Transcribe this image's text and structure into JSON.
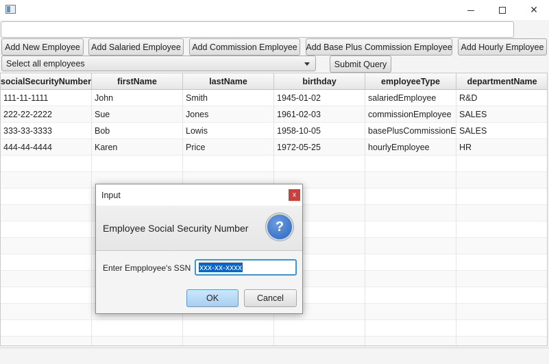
{
  "window": {
    "title": "",
    "icon": "app-window-icon",
    "minimize_icon": "minimize-icon",
    "maximize_icon": "maximize-icon",
    "close_icon": "close-icon",
    "close_label": "✕"
  },
  "query": {
    "value": "",
    "placeholder": ""
  },
  "buttons": {
    "add_new": "Add New Employee",
    "add_salaried": "Add Salaried Employee",
    "add_commission": "Add Commission Employee",
    "add_base_plus": "Add Base Plus Commission Employee",
    "add_hourly": "Add Hourly Employee",
    "submit": "Submit Query"
  },
  "query_select": {
    "selected": "Select all employees"
  },
  "table": {
    "columns": [
      "socialSecurityNumber",
      "firstName",
      "lastName",
      "birthday",
      "employeeType",
      "departmentName"
    ],
    "rows": [
      [
        "111-11-1111",
        "John",
        "Smith",
        "1945-01-02",
        "salariedEmployee",
        "R&D"
      ],
      [
        "222-22-2222",
        "Sue",
        "Jones",
        "1961-02-03",
        "commissionEmployee",
        "SALES"
      ],
      [
        "333-33-3333",
        "Bob",
        "Lowis",
        "1958-10-05",
        "basePlusCommissionE...",
        "SALES"
      ],
      [
        "444-44-4444",
        "Karen",
        "Price",
        "1972-05-25",
        "hourlyEmployee",
        "HR"
      ]
    ]
  },
  "dialog": {
    "title": "Input",
    "close_label": "x",
    "header": "Employee Social Security Number",
    "help_icon": "question-mark-icon",
    "help_glyph": "?",
    "field_label": "Enter Empployee's SSN",
    "field_value": "xxx-xx-xxxx",
    "ok": "OK",
    "cancel": "Cancel"
  }
}
